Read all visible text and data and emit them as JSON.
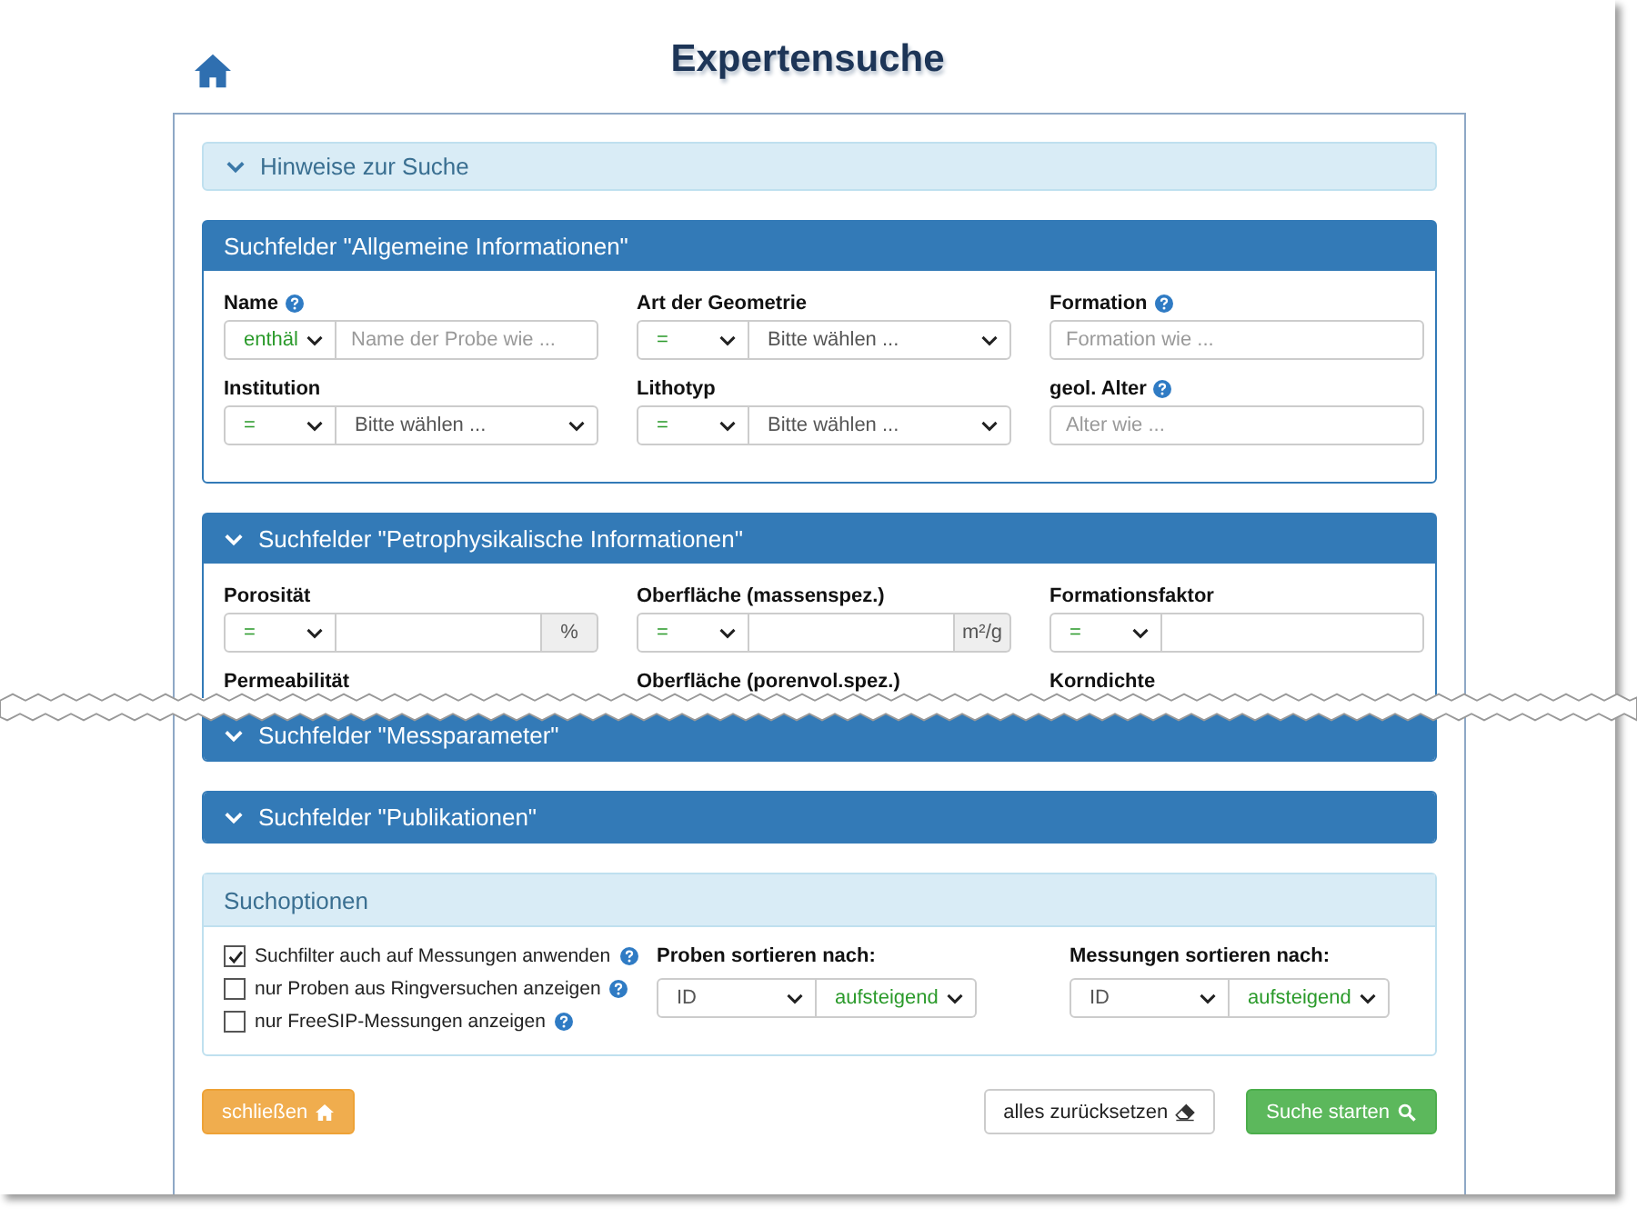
{
  "title": "Expertensuche",
  "hints": {
    "label": "Hinweise zur Suche"
  },
  "sections": [
    {
      "title": "Suchfelder \"Allgemeine Informationen\"",
      "collapsible": false,
      "fields": [
        {
          "label": "Name",
          "help": true,
          "kind": "text",
          "operator": "enthäl",
          "placeholder": "Name der Probe wie ..."
        },
        {
          "label": "Art der Geometrie",
          "help": false,
          "kind": "select",
          "operator": "=",
          "value": "Bitte wählen ..."
        },
        {
          "label": "Formation",
          "help": true,
          "kind": "plain",
          "placeholder": "Formation wie ..."
        },
        {
          "label": "Institution",
          "help": false,
          "kind": "select",
          "operator": "=",
          "value": "Bitte wählen ..."
        },
        {
          "label": "Lithotyp",
          "help": false,
          "kind": "select",
          "operator": "=",
          "value": "Bitte wählen ..."
        },
        {
          "label": "geol. Alter",
          "help": true,
          "kind": "plain",
          "placeholder": "Alter wie ..."
        }
      ]
    },
    {
      "title": "Suchfelder \"Petrophysikalische Informationen\"",
      "collapsible": true,
      "torn": true,
      "fields": [
        {
          "label": "Porosität",
          "help": false,
          "kind": "unit",
          "operator": "=",
          "unit": "%"
        },
        {
          "label": "Oberfläche (massenspez.)",
          "help": false,
          "kind": "unit",
          "operator": "=",
          "unit": "m²/g"
        },
        {
          "label": "Formationsfaktor",
          "help": false,
          "kind": "text",
          "operator": "="
        },
        {
          "label": "Permeabilität",
          "help": false,
          "kind": "label"
        },
        {
          "label": "Oberfläche (porenvol.spez.)",
          "help": false,
          "kind": "label"
        },
        {
          "label": "Korndichte",
          "help": false,
          "kind": "label"
        }
      ]
    },
    {
      "title": "Suchfelder \"Messparameter\"",
      "collapsible": true
    },
    {
      "title": "Suchfelder \"Publikationen\"",
      "collapsible": true
    }
  ],
  "options": {
    "title": "Suchoptionen",
    "checkboxes": [
      {
        "label": "Suchfilter auch auf Messungen anwenden",
        "checked": true,
        "help": true
      },
      {
        "label": "nur Proben aus Ringversuchen anzeigen",
        "checked": false,
        "help": true
      },
      {
        "label": "nur FreeSIP-Messungen anzeigen",
        "checked": false,
        "help": true
      }
    ],
    "sorts": [
      {
        "label": "Proben sortieren nach:",
        "field": "ID",
        "order": "aufsteigend"
      },
      {
        "label": "Messungen sortieren nach:",
        "field": "ID",
        "order": "aufsteigend"
      }
    ]
  },
  "buttons": [
    {
      "label": "schließen",
      "kind": "close"
    },
    {
      "label": "alles zurücksetzen",
      "kind": "reset"
    },
    {
      "label": "Suche starten",
      "kind": "search"
    }
  ]
}
